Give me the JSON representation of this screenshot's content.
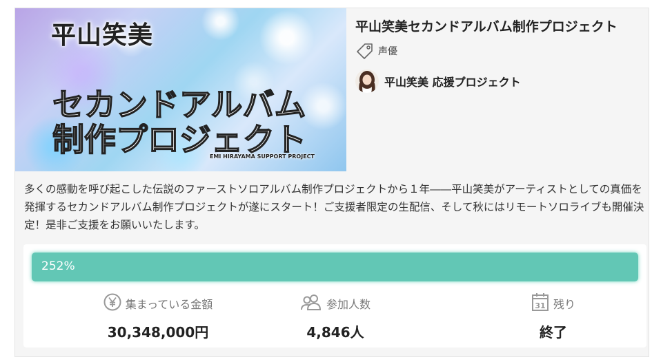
{
  "hero": {
    "name": "平山笑美",
    "line1": "セカンドアルバム",
    "line2": "制作プロジェクト",
    "small": "EMI HIRAYAMA SUPPORT PROJECT"
  },
  "project": {
    "title": "平山笑美セカンドアルバム制作プロジェクト",
    "tag": "声優",
    "tag_icon": "tag-icon",
    "owner_name": "平山笑美 応援プロジェクト",
    "description": "多くの感動を呼び起こした伝説のファーストソロアルバム制作プロジェクトから１年――平山笑美がアーティストとしての真価を発揮するセカンドアルバム制作プロジェクトが遂にスタート！ご支援者限定の生配信、そして秋にはリモートソロライブも開催決定！是非ご支援をお願いいたします。"
  },
  "progress": {
    "label": "252%",
    "fill_fraction": 1.0,
    "color": "#62c7b5"
  },
  "stats": [
    {
      "icon": "yen-icon",
      "label": "集まっている金額",
      "value": "30,348,000円"
    },
    {
      "icon": "people-icon",
      "label": "参加人数",
      "value": "4,846人"
    },
    {
      "icon": "calendar-icon",
      "label": "残り",
      "value": "終了"
    }
  ],
  "colors": {
    "accent": "#62c7b5",
    "icon_gray": "#999999"
  }
}
